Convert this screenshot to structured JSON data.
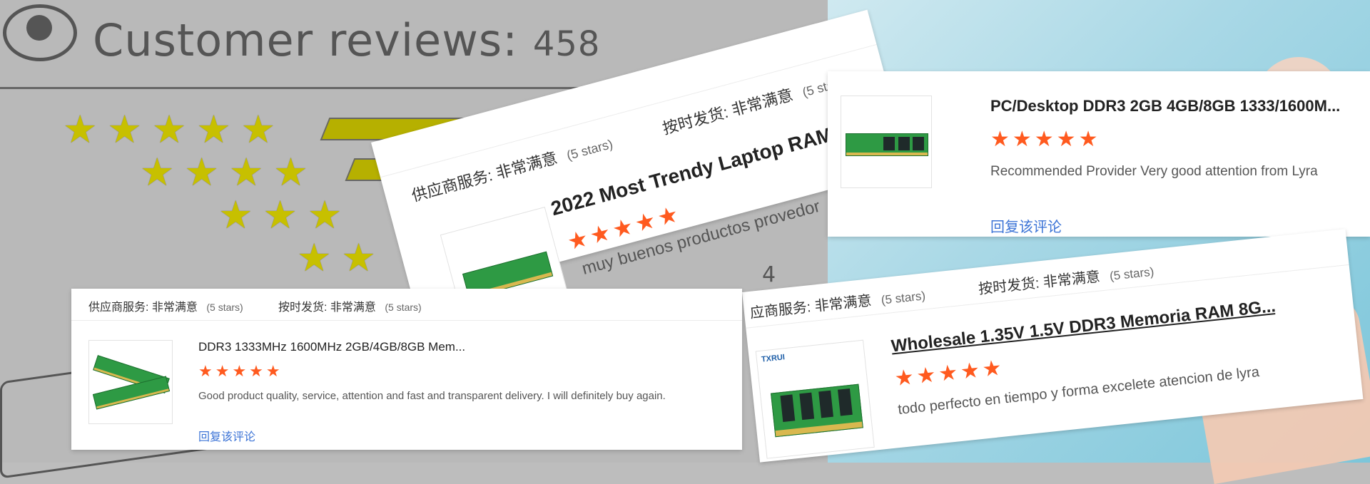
{
  "background": {
    "title_prefix": "Customer reviews:",
    "title_count": "458",
    "bar_number": "4",
    "star_glyph": "★",
    "colors": {
      "left_bg": "#b9b9b9",
      "star_olive": "#c7c000",
      "right_bg": "#a9d8e6"
    }
  },
  "card_front": {
    "supplier_service_label": "供应商服务:",
    "supplier_service_value": "非常满意",
    "supplier_service_stars": "(5 stars)",
    "on_time_label": "按时发货:",
    "on_time_value": "非常满意",
    "on_time_stars": "(5 stars)",
    "title": "DDR3 1333MHz 1600MHz 2GB/4GB/8GB Mem...",
    "rating": "★★★★★",
    "review": "Good product quality, service, attention and fast and transparent delivery. I will definitely buy again.",
    "reply_link": "回复该评论"
  },
  "card_tilted_left": {
    "supplier_service_label": "供应商服务:",
    "supplier_service_value": "非常满意",
    "supplier_service_stars": "(5 stars)",
    "on_time_label": "按时发货:",
    "on_time_value": "非常满意",
    "on_time_stars": "(5 stars)",
    "title": "2022 Most Trendy Laptop RAM (",
    "rating": "★★★★★",
    "review": "muy buenos productos provedor"
  },
  "card_top_right": {
    "title": "PC/Desktop DDR3 2GB 4GB/8GB 1333/1600M...",
    "rating": "★★★★★",
    "review": "Recommended Provider Very good attention from Lyra",
    "reply_link": "回复该评论"
  },
  "card_bottom_right": {
    "supplier_service_label": "应商服务:",
    "supplier_service_value": "非常满意",
    "supplier_service_stars": "(5 stars)",
    "on_time_label": "按时发货:",
    "on_time_value": "非常满意",
    "on_time_stars": "(5 stars)",
    "title": "Wholesale 1.35V 1.5V DDR3 Memoria RAM 8G...",
    "rating": "★★★★★",
    "review": "todo perfecto en tiempo y forma excelete atencion de lyra",
    "brand_logo": "TXRUI"
  }
}
